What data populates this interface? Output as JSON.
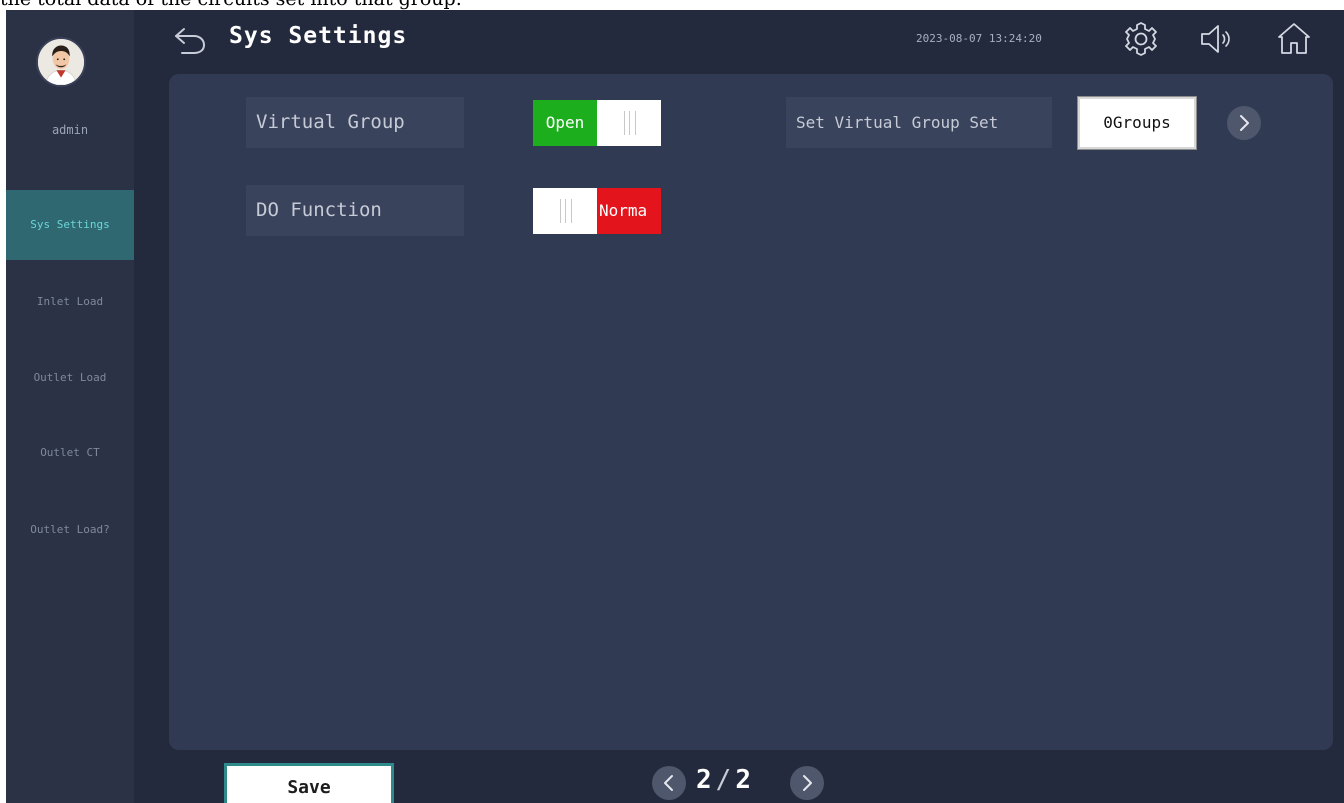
{
  "caption": "the total data of the circuits set into that group.",
  "header": {
    "title": "Sys Settings",
    "datetime": "2023-08-07 13:24:20",
    "icons": [
      "back-arrow-icon",
      "gear-icon",
      "speaker-icon",
      "home-icon"
    ]
  },
  "user": {
    "name": "admin"
  },
  "sidebar": {
    "items": [
      {
        "label": "Sys Settings",
        "active": true
      },
      {
        "label": "Inlet Load",
        "active": false
      },
      {
        "label": "Outlet Load",
        "active": false
      },
      {
        "label": "Outlet CT",
        "active": false
      },
      {
        "label": "Outlet Load?",
        "active": false
      }
    ]
  },
  "settings": {
    "virtual_group": {
      "label": "Virtual Group",
      "state_text": "Open",
      "state": "on",
      "color": "#1cae1c"
    },
    "do_function": {
      "label": "DO Function",
      "state_text": "Norma",
      "state": "off",
      "color": "#e3141c"
    },
    "virtual_group_set": {
      "label": "Set Virtual Group Set",
      "value": "0Groups"
    }
  },
  "footer": {
    "save_label": "Save",
    "current_page": "2",
    "separator": "/",
    "total_pages": "2"
  },
  "colors": {
    "background": "#242a3d",
    "panel": "#313a53",
    "accent": "#2f8a8c",
    "active_nav_text": "#69d6d8"
  }
}
